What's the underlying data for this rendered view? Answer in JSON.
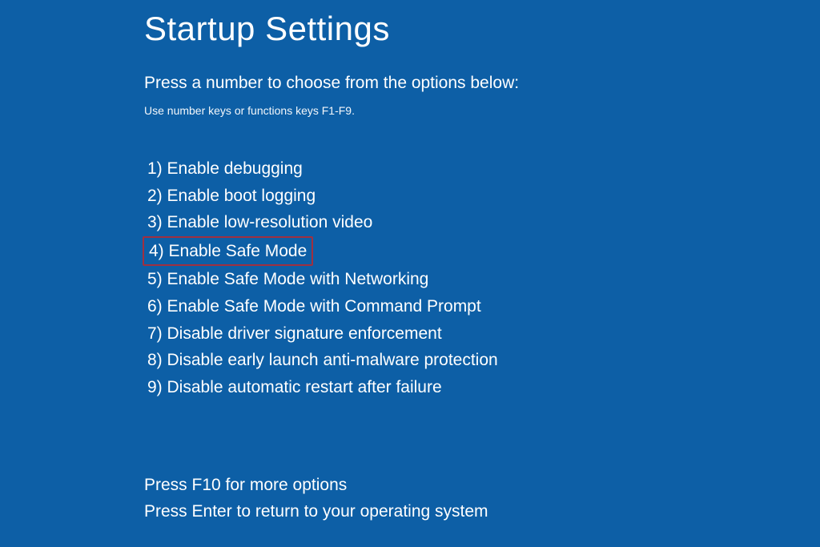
{
  "title": "Startup Settings",
  "subtitle": "Press a number to choose from the options below:",
  "hint": "Use number keys or functions keys F1-F9.",
  "options": [
    {
      "label": "1) Enable debugging",
      "highlighted": false
    },
    {
      "label": "2) Enable boot logging",
      "highlighted": false
    },
    {
      "label": "3) Enable low-resolution video",
      "highlighted": false
    },
    {
      "label": "4) Enable Safe Mode",
      "highlighted": true
    },
    {
      "label": "5) Enable Safe Mode with Networking",
      "highlighted": false
    },
    {
      "label": "6) Enable Safe Mode with Command Prompt",
      "highlighted": false
    },
    {
      "label": "7) Disable driver signature enforcement",
      "highlighted": false
    },
    {
      "label": "8) Disable early launch anti-malware protection",
      "highlighted": false
    },
    {
      "label": "9) Disable automatic restart after failure",
      "highlighted": false
    }
  ],
  "footer": {
    "line1": "Press F10 for more options",
    "line2": "Press Enter to return to your operating system"
  }
}
